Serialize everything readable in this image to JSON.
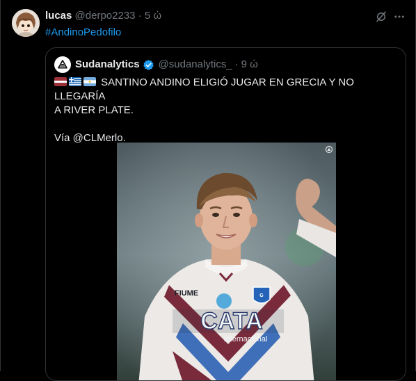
{
  "post": {
    "author_name": "lucas",
    "author_handle": "@derpo2233",
    "separator": "·",
    "time": "5 ώ",
    "hashtag": "#AndinoPedofilo"
  },
  "quoted": {
    "author_name": "Sudanalytics",
    "author_handle": "@sudanalytics_",
    "separator": "·",
    "time": "9 ώ",
    "line1": "SANTINO ANDINO ELIGIÓ JUGAR EN GRECIA Y NO LLEGARÍA",
    "line2": "A RIVER PLATE.",
    "line3": "Vía @CLMerlo.",
    "flags": [
      "latvia-flag",
      "greece-flag",
      "argentina-flag"
    ],
    "image_description_hidden": "",
    "jersey_sponsor": "CATA",
    "jersey_subtext": "Internacional",
    "jersey_brand": "FIUME"
  },
  "icons": {
    "grok": "grok-icon",
    "more": "more-icon",
    "verified": "verified-icon",
    "sudanalytics_logo": "sudanalytics-logo-icon"
  },
  "colors": {
    "background": "#000000",
    "text": "#e7e9ea",
    "muted": "#71767b",
    "link": "#1d9bf0",
    "border": "#2f3336"
  }
}
